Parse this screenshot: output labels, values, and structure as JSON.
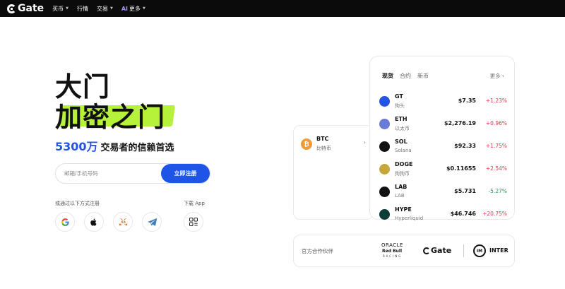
{
  "nav": {
    "brand": "Gate",
    "items": [
      {
        "label": "买币",
        "caret": true
      },
      {
        "label": "行情",
        "caret": false
      },
      {
        "label": "交易",
        "caret": true
      },
      {
        "label": "更多",
        "caret": true,
        "badge": "AI"
      }
    ]
  },
  "hero": {
    "line1": "大门",
    "line2": "加密之门",
    "highlight_color": "#b6f23a",
    "subtitle_number": "5300万",
    "subtitle_text": "交易者的信赖首选"
  },
  "signup": {
    "placeholder": "邮箱/手机号码",
    "button": "立即注册",
    "alt_label": "或通过以下方式注册",
    "app_label": "下载 App",
    "providers": [
      "google-icon",
      "apple-icon",
      "metamask-icon",
      "telegram-icon",
      "qr-code-icon"
    ]
  },
  "market": {
    "tabs": [
      "现货",
      "合约",
      "新币"
    ],
    "active_tab": "现货",
    "more": "更多",
    "rows": [
      {
        "symbol": "GT",
        "name": "狗头",
        "price": "$7.35",
        "change": "+1.23%",
        "dir": "up",
        "color": "#2354e6"
      },
      {
        "symbol": "ETH",
        "name": "以太币",
        "price": "$2,276.19",
        "change": "+0.96%",
        "dir": "up",
        "color": "#6a7bd6"
      },
      {
        "symbol": "SOL",
        "name": "Solana",
        "price": "$92.33",
        "change": "+1.75%",
        "dir": "up",
        "color": "#111111"
      },
      {
        "symbol": "DOGE",
        "name": "狗狗币",
        "price": "$0.11655",
        "change": "+2.54%",
        "dir": "up",
        "color": "#c8a73a"
      },
      {
        "symbol": "LAB",
        "name": "LAB",
        "price": "$5.731",
        "change": "-5.27%",
        "dir": "down",
        "color": "#111111"
      },
      {
        "symbol": "HYPE",
        "name": "Hyperliquid",
        "price": "$46.746",
        "change": "+20.75%",
        "dir": "up",
        "color": "#0d3b36"
      }
    ]
  },
  "btc": {
    "symbol": "BTC",
    "name": "比特币",
    "color": "#f09a35"
  },
  "partners": {
    "label": "官方合作伙伴",
    "oracle": "ORACLE",
    "redbull": "Red Bull",
    "racing": "RACING",
    "gate": "Gate",
    "inter": "INTER"
  }
}
